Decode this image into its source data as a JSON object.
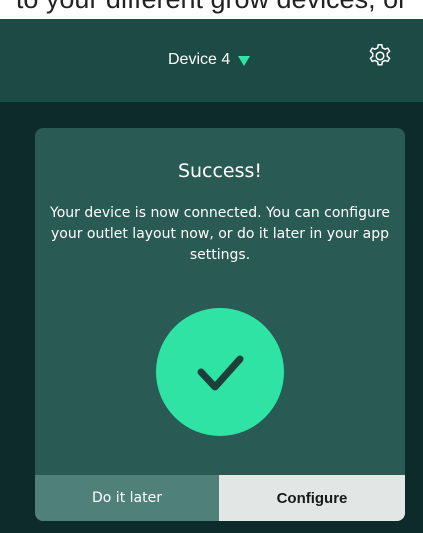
{
  "top_strip": {
    "text": "to your different grow devices, or"
  },
  "header": {
    "device_name": "Device 4",
    "dropdown_icon": "caret-down-icon",
    "settings_icon": "gear-icon"
  },
  "card": {
    "title": "Success!",
    "message": "Your device is now connected. You can configure your outlet layout now, or do it later in your app settings.",
    "status_icon": "check-icon",
    "later_label": "Do it later",
    "configure_label": "Configure"
  },
  "colors": {
    "background": "#0c2b29",
    "header": "#1c4b45",
    "card": "#2a5a54",
    "accent": "#2fe3a4",
    "later_button": "#50807a",
    "configure_button": "#e2e6e5"
  }
}
